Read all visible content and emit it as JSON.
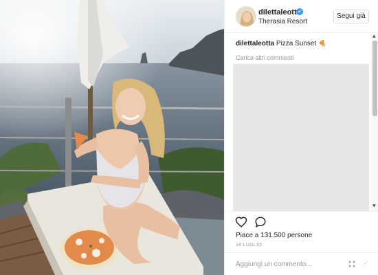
{
  "post": {
    "username": "dilettaleotta",
    "verified_glyph": "✔",
    "location": "Therasia Resort",
    "follow_label": "Segui già",
    "caption_user": "dilettaleotta",
    "caption_text": "Pizza Sunset",
    "caption_emoji": "🍕",
    "load_more": "Carica altri commenti",
    "likes": "Piace a 131.500 persone",
    "date": "16 LUGLIO",
    "comment_placeholder": "Aggiungi un commento..."
  },
  "icons": {
    "like": "heart-icon",
    "comment": "comment-bubble-icon",
    "more": "more-options-icon",
    "verified": "verified-badge-icon"
  },
  "colors": {
    "accent": "#3897f0",
    "text": "#262626",
    "muted": "#999999",
    "border": "#efefef"
  }
}
